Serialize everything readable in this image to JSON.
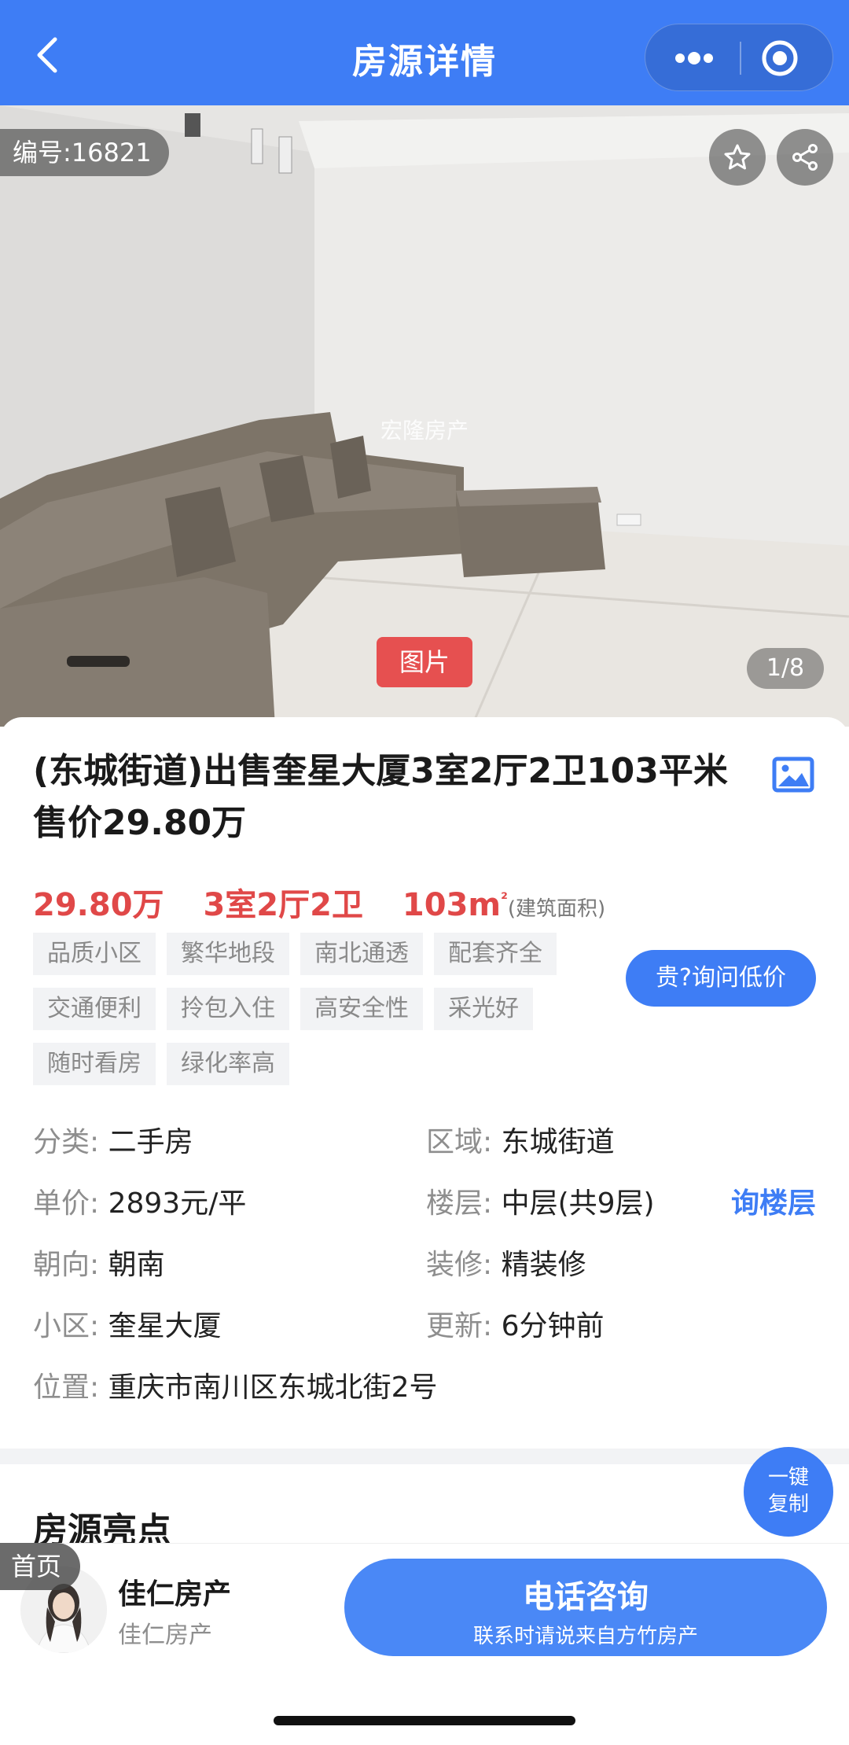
{
  "header": {
    "title": "房源详情",
    "back_icon": "chevron-left-icon",
    "more_icon": "more-dots-icon",
    "close_icon": "target-icon",
    "bg_color": "#3e7df5"
  },
  "gallery": {
    "id_label": "编号:16821",
    "watermark": "宏隆房产",
    "tag": "图片",
    "pager": "1/8"
  },
  "listing": {
    "title": "(东城街道)出售奎星大厦3室2厅2卫103平米 售价29.80万",
    "price": "29.80万",
    "layout": "3室2厅2卫",
    "area": "103m",
    "area_sup": "²",
    "area_note": "(建筑面积)",
    "tags": [
      "品质小区",
      "繁华地段",
      "南北通透",
      "配套齐全",
      "交通便利",
      "拎包入住",
      "高安全性",
      "采光好",
      "随时看房",
      "绿化率高"
    ],
    "ask_price_button": "贵?询问低价",
    "info": {
      "category_key": "分类:",
      "category_val": "二手房",
      "district_key": "区域:",
      "district_val": "东城街道",
      "unit_price_key": "单价:",
      "unit_price_val": "2893元/平",
      "floor_key": "楼层:",
      "floor_val": "中层(共9层)",
      "ask_floor": "询楼层",
      "orientation_key": "朝向:",
      "orientation_val": "朝南",
      "decoration_key": "装修:",
      "decoration_val": "精装修",
      "community_key": "小区:",
      "community_val": "奎星大厦",
      "updated_key": "更新:",
      "updated_val": "6分钟前",
      "location_key": "位置:",
      "location_val": "重庆市南川区东城北街2号"
    },
    "highlights_title": "房源亮点"
  },
  "floating": {
    "copy_line1": "一键",
    "copy_line2": "复制"
  },
  "bottom": {
    "home_tab": "首页",
    "agent_name": "佳仁房产",
    "agent_company": "佳仁房产",
    "call_title": "电话咨询",
    "call_sub": "联系时请说来自方竹房产"
  }
}
